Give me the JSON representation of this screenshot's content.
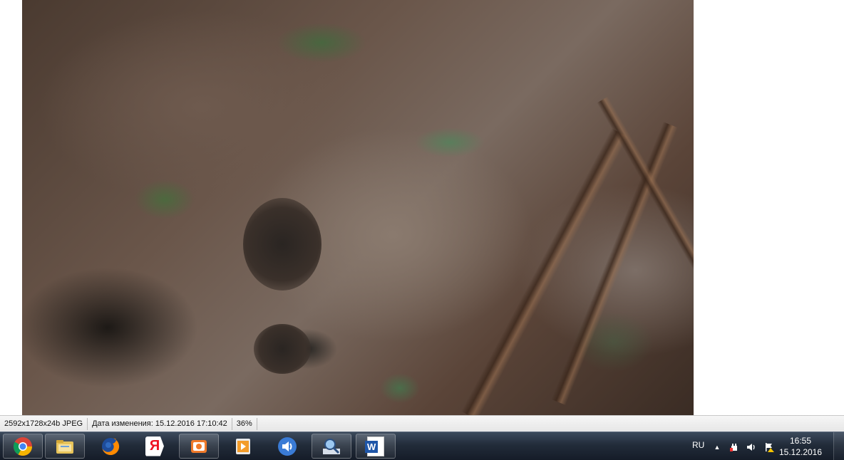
{
  "viewer": {
    "image_alt": "Close-up photo of a bronze surface with embossed markings"
  },
  "statusbar": {
    "image_info": "2592x1728x24b JPEG",
    "modified": "Дата изменения: 15.12.2016 17:10:42",
    "zoom": "36%"
  },
  "taskbar": {
    "apps": [
      {
        "name": "chrome-icon",
        "active": true
      },
      {
        "name": "explorer-icon",
        "active": true
      },
      {
        "name": "firefox-icon",
        "active": false
      },
      {
        "name": "yandex-browser-icon",
        "active": false
      },
      {
        "name": "image-viewer-icon",
        "active": true
      },
      {
        "name": "media-player-icon",
        "active": false
      },
      {
        "name": "audio-app-icon",
        "active": false
      },
      {
        "name": "search-tool-icon",
        "active": true
      },
      {
        "name": "word-icon",
        "active": true
      }
    ],
    "yandex_letter": "Я",
    "word_letter": "W"
  },
  "tray": {
    "language": "RU",
    "show_hidden": "▲",
    "time": "16:55",
    "date": "15.12.2016"
  },
  "colors": {
    "taskbar": "#1c2533",
    "statusbar": "#eeeeee"
  }
}
